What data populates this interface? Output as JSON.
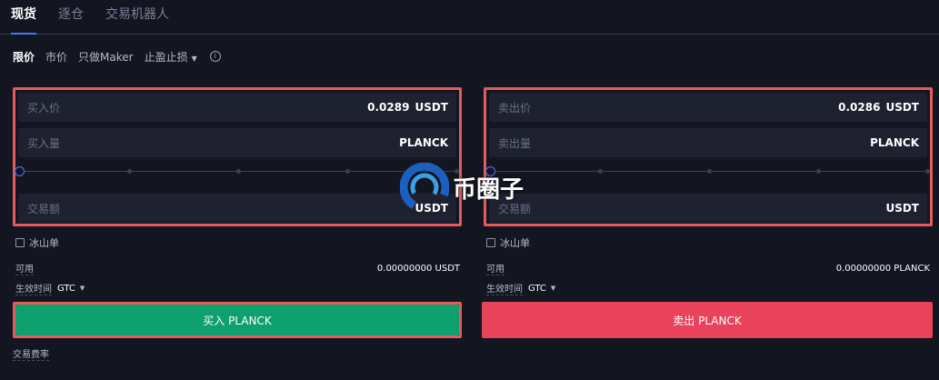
{
  "top_tabs": [
    {
      "label": "现货",
      "active": true
    },
    {
      "label": "逐仓",
      "active": false
    },
    {
      "label": "交易机器人",
      "active": false
    }
  ],
  "order_types": {
    "limit": "限价",
    "market": "市价",
    "maker_only": "只做Maker",
    "tp_sl": "止盈止损"
  },
  "buy": {
    "price_label": "买入价",
    "price_value": "0.0289",
    "price_unit": "USDT",
    "amount_label": "买入量",
    "amount_unit": "PLANCK",
    "total_label": "交易额",
    "total_unit": "USDT",
    "iceberg_label": "冰山单",
    "available_label": "可用",
    "available_value": "0.00000000 USDT",
    "tif_label": "生效时间",
    "tif_value": "GTC",
    "button_label": "买入 PLANCK"
  },
  "sell": {
    "price_label": "卖出价",
    "price_value": "0.0286",
    "price_unit": "USDT",
    "amount_label": "卖出量",
    "amount_unit": "PLANCK",
    "total_label": "交易额",
    "total_unit": "USDT",
    "iceberg_label": "冰山单",
    "available_label": "可用",
    "available_value": "0.00000000 PLANCK",
    "tif_label": "生效时间",
    "tif_value": "GTC",
    "button_label": "卖出 PLANCK"
  },
  "fee_label": "交易费率",
  "watermark_text": "币圈子",
  "slider_level": 0,
  "colors": {
    "background": "#131521",
    "accent": "#3d7bfd",
    "buy": "#0ea06e",
    "sell": "#e8435a",
    "highlight_border": "#e35b5b"
  }
}
